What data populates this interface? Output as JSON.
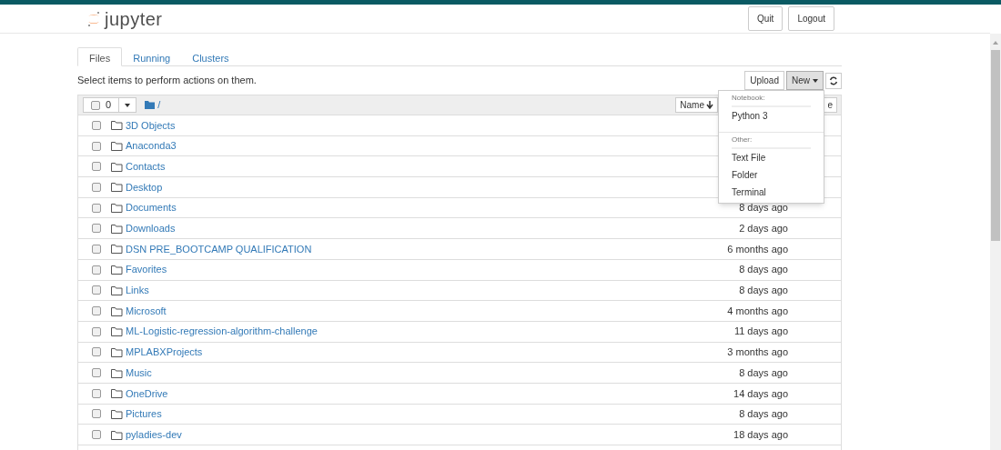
{
  "header": {
    "logo_text": "jupyter",
    "buttons": [
      "Quit",
      "Logout"
    ]
  },
  "tabs": [
    {
      "label": "Files",
      "selected": true
    },
    {
      "label": "Running",
      "selected": false
    },
    {
      "label": "Clusters",
      "selected": false
    }
  ],
  "instructions": "Select items to perform actions on them.",
  "toolbar": {
    "upload": "Upload",
    "new": "New",
    "new_open": true
  },
  "list_header": {
    "all_checked": false,
    "selected_count": "0",
    "path": "/",
    "sort_button": "Name",
    "partial_column": "e"
  },
  "new_menu": {
    "sections": [
      {
        "heading": "Notebook:",
        "items": [
          "Python 3"
        ]
      },
      {
        "heading": "Other:",
        "items": [
          "Text File",
          "Folder",
          "Terminal"
        ]
      }
    ]
  },
  "files": [
    {
      "name": "3D Objects",
      "checked": false
    },
    {
      "name": "Anaconda3",
      "checked": false
    },
    {
      "name": "Contacts",
      "checked": false
    },
    {
      "name": "Desktop",
      "checked": false
    },
    {
      "name": "Documents",
      "checked": false,
      "modified": "8 days ago"
    },
    {
      "name": "Downloads",
      "checked": false,
      "modified": "2 days ago"
    },
    {
      "name": "DSN PRE_BOOTCAMP QUALIFICATION",
      "checked": false,
      "modified": "6 months ago"
    },
    {
      "name": "Favorites",
      "checked": false,
      "modified": "8 days ago"
    },
    {
      "name": "Links",
      "checked": false,
      "modified": "8 days ago"
    },
    {
      "name": "Microsoft",
      "checked": false,
      "modified": "4 months ago"
    },
    {
      "name": "ML-Logistic-regression-algorithm-challenge",
      "checked": false,
      "modified": "11 days ago"
    },
    {
      "name": "MPLABXProjects",
      "checked": false,
      "modified": "3 months ago"
    },
    {
      "name": "Music",
      "checked": false,
      "modified": "8 days ago"
    },
    {
      "name": "OneDrive",
      "checked": false,
      "modified": "14 days ago"
    },
    {
      "name": "Pictures",
      "checked": false,
      "modified": "8 days ago"
    },
    {
      "name": "pyladies-dev",
      "checked": false,
      "modified": "18 days ago"
    }
  ]
}
